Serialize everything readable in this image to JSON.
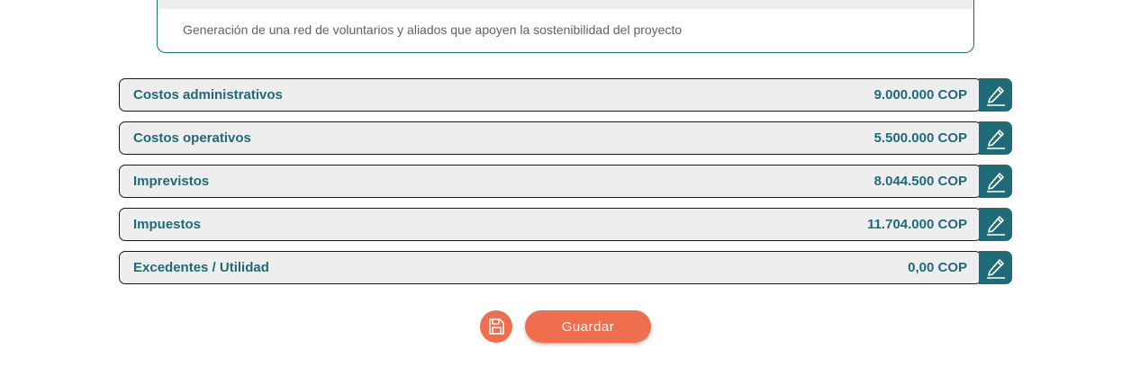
{
  "objective_card": {
    "text": "Generación de una red de voluntarios y aliados que apoyen la sostenibilidad del proyecto"
  },
  "cost_rows": [
    {
      "label": "Costos administrativos",
      "value": "9.000.000 COP"
    },
    {
      "label": "Costos operativos",
      "value": "5.500.000 COP"
    },
    {
      "label": "Imprevistos",
      "value": "8.044.500 COP"
    },
    {
      "label": "Impuestos",
      "value": "11.704.000 COP"
    },
    {
      "label": "Excedentes / Utilidad",
      "value": "0,00 COP"
    }
  ],
  "actions": {
    "save_label": "Guardar"
  },
  "colors": {
    "accent": "#1e6b78",
    "button": "#ee6e4e",
    "row_bg": "#eeeeee"
  }
}
